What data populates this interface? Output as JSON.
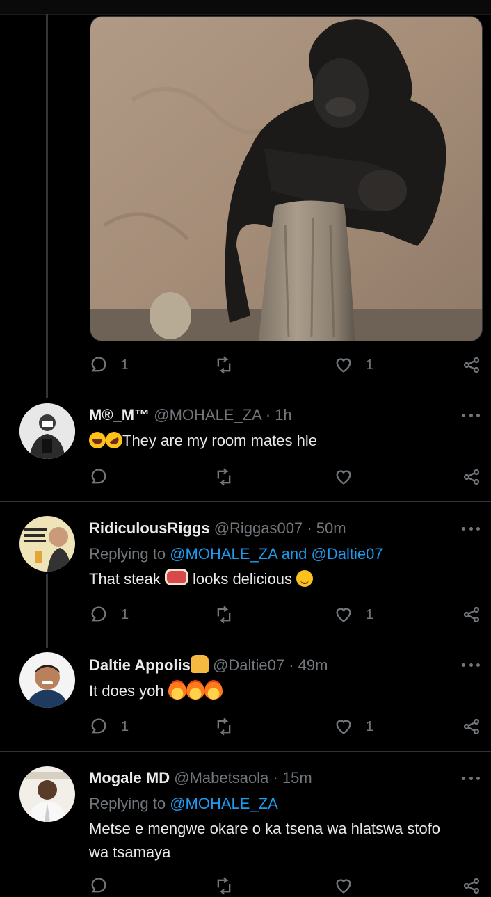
{
  "media_tweet": {
    "image_alt": "gorilla leaning on tree stump",
    "stats": {
      "replies": "1",
      "retweets": "",
      "likes": "1"
    }
  },
  "replies": [
    {
      "name": "M®_M™",
      "handle": "@MOHALE_ZA",
      "time": "· 1h",
      "replying_prefix": "",
      "replying_to": "",
      "text": "They are my room mates hle",
      "emojis": [
        "face-with-tears-of-joy",
        "rolling-on-floor-laughing"
      ],
      "stats": {
        "replies": "",
        "retweets": "",
        "likes": ""
      }
    },
    {
      "name": "RidiculousRiggs",
      "handle": "@Riggas007",
      "time": "· 50m",
      "replying_prefix": "Replying to",
      "replying_to": "@MOHALE_ZA and @Daltie07",
      "text_before": "That steak",
      "text_after": "looks delicious",
      "emojis": [
        "cut-of-meat",
        "smiling-face"
      ],
      "stats": {
        "replies": "1",
        "retweets": "",
        "likes": "1"
      }
    },
    {
      "name": "Daltie Appolis",
      "handle": "@Daltie07",
      "time": "· 49m",
      "replying_prefix": "",
      "replying_to": "",
      "text": "It does yoh",
      "emojis": [
        "folded-hands",
        "fire",
        "fire",
        "fire"
      ],
      "stats": {
        "replies": "1",
        "retweets": "",
        "likes": "1"
      }
    },
    {
      "name": "Mogale MD",
      "handle": "@Mabetsaola",
      "time": "· 15m",
      "replying_prefix": "Replying to",
      "replying_to": "@MOHALE_ZA",
      "text_line1": "Metse e mengwe okare o ka tsena wa hlatswa stofo",
      "text_line2": "wa tsamaya",
      "stats": {
        "replies": "",
        "retweets": "",
        "likes": ""
      }
    }
  ],
  "colors": {
    "background": "#000000",
    "text": "#e7e9ea",
    "muted": "#71767b",
    "link": "#1d9bf0",
    "divider": "#2f3336"
  }
}
